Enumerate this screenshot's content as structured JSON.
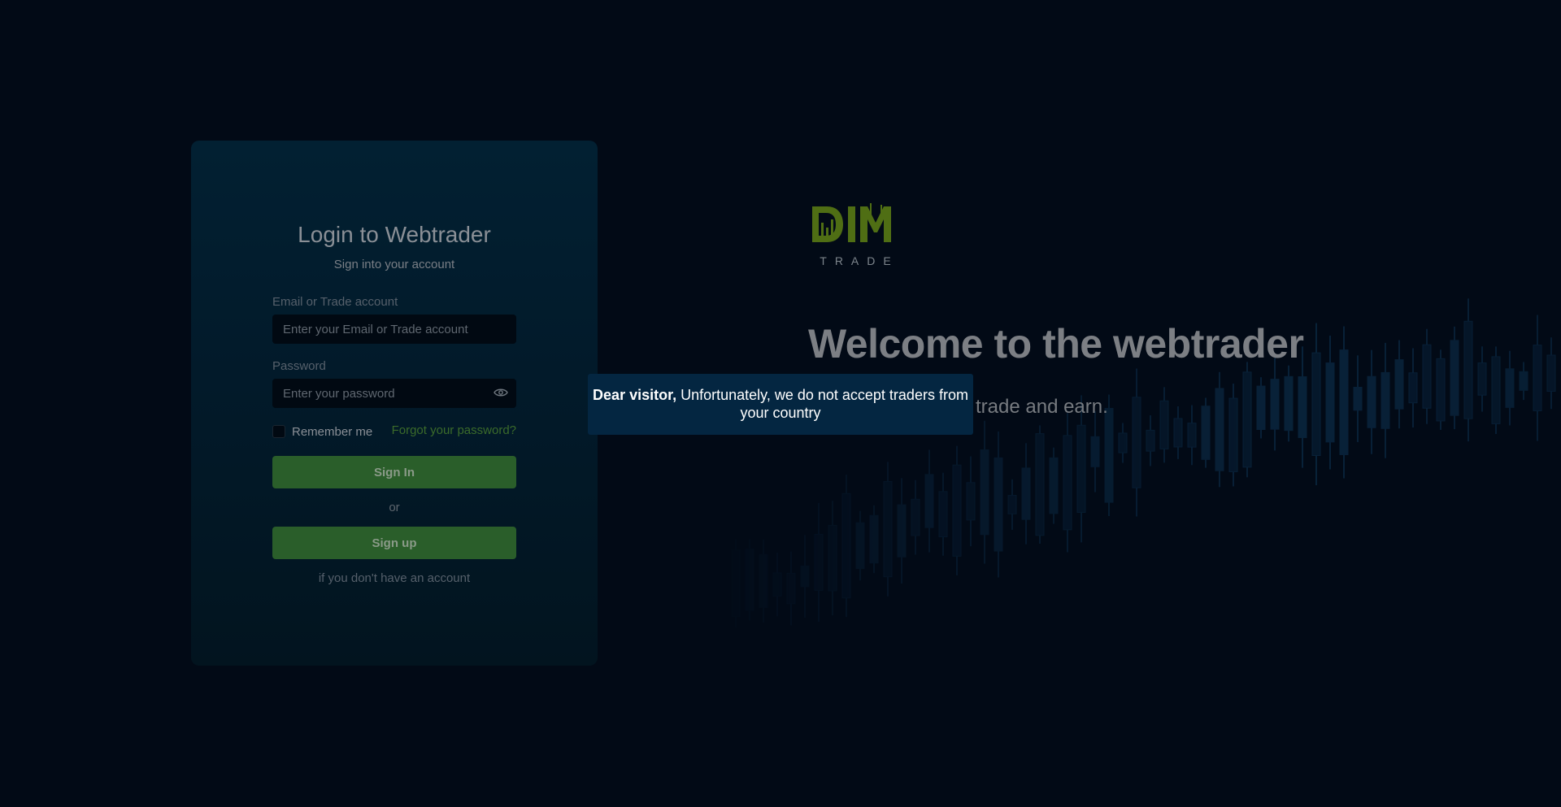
{
  "login": {
    "title": "Login to Webtrader",
    "subtitle": "Sign into your account",
    "email_label": "Email or Trade account",
    "email_placeholder": "Enter your Email or Trade account",
    "email_value": "",
    "password_label": "Password",
    "password_placeholder": "Enter your password",
    "password_value": "",
    "remember_label": "Remember me",
    "forgot_label": "Forgot your password?",
    "signin_label": "Sign In",
    "or_label": "or",
    "signup_label": "Sign up",
    "signup_hint": "if you don't have an account"
  },
  "brand": {
    "logo_text": "DIM",
    "logo_subtext": "TRADE",
    "logo_color": "#4f6e14"
  },
  "hero": {
    "welcome": "Welcome to the webtrader",
    "tagline": "trade and earn."
  },
  "modal": {
    "lead": "Dear visitor,",
    "message": "Unfortunately, we do not accept traders from your country"
  },
  "colors": {
    "background": "#020a16",
    "card": "#022032",
    "button": "#2a5e2a",
    "modal": "#042641",
    "candles": "#0b2a45"
  },
  "icons": {
    "password_toggle": "eye-icon"
  }
}
